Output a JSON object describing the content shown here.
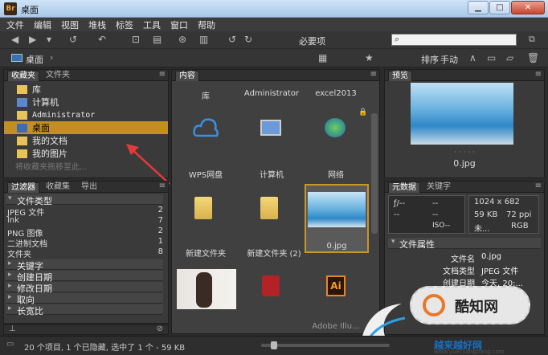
{
  "window": {
    "title": "桌面",
    "app_icon_text": "Br"
  },
  "menu": [
    "文件",
    "编辑",
    "视图",
    "堆栈",
    "标签",
    "工具",
    "窗口",
    "帮助"
  ],
  "toolbar": {
    "workspace": "必要项",
    "search_placeholder": ""
  },
  "path": {
    "crumb": "桌面",
    "sort_label": "排序",
    "sort_value": "手动"
  },
  "favorites": {
    "tabs": [
      "收藏夹",
      "文件夹"
    ],
    "items": [
      {
        "label": "库"
      },
      {
        "label": "计算机"
      },
      {
        "label": "Administrator"
      },
      {
        "label": "桌面",
        "selected": true
      },
      {
        "label": "我的文档"
      },
      {
        "label": "我的图片"
      }
    ],
    "hint": "将收藏夹拖移至此..."
  },
  "filter": {
    "tabs": [
      "过滤器",
      "收藏集",
      "导出"
    ],
    "group_file_type": "文件类型",
    "rows": [
      {
        "label": "JPEG 文件",
        "count": "2"
      },
      {
        "label": "lnk",
        "count": "7"
      },
      {
        "label": "PNG 图像",
        "count": "2"
      },
      {
        "label": "二进制文档",
        "count": "1"
      },
      {
        "label": "文件夹",
        "count": "8"
      }
    ],
    "groups": [
      "关键字",
      "创建日期",
      "修改日期",
      "取向",
      "长宽比"
    ]
  },
  "content": {
    "tab": "内容",
    "items": [
      {
        "label": "库"
      },
      {
        "label": "Administrator"
      },
      {
        "label": "excel2013"
      },
      {
        "label": "WPS网盘"
      },
      {
        "label": "计算机"
      },
      {
        "label": "网络"
      },
      {
        "label": "新建文件夹"
      },
      {
        "label": "新建文件夹 (2)"
      },
      {
        "label": "0.jpg"
      },
      {
        "label": ""
      },
      {
        "label": ""
      },
      {
        "label": "Adobe Illu..."
      }
    ]
  },
  "preview": {
    "tab": "预览",
    "filename": "0.jpg",
    "dots": "· · · · ·"
  },
  "metadata": {
    "tabs": [
      "元数据",
      "关键字"
    ],
    "camera": {
      "fstop": "ƒ/--",
      "shutter": "--",
      "a": "--",
      "b": "--",
      "iso": "ISO--"
    },
    "info": {
      "dims": "1024 x 682",
      "size": "59 KB",
      "ppi": "72 ppi",
      "profile": "未...",
      "mode": "RGB"
    },
    "section": "文件属性",
    "rows": [
      {
        "k": "文件名",
        "v": "0.jpg"
      },
      {
        "k": "文档类型",
        "v": "JPEG 文件"
      },
      {
        "k": "创建日期",
        "v": "今天, 20:..."
      }
    ]
  },
  "status": {
    "text": "20 个项目, 1 个已隐藏, 选中了 1 个 - 59 KB"
  },
  "watermark": {
    "site": "酷知网",
    "site2": "越来越好网",
    "url": "www.yuecyangbang.com"
  },
  "colors": {
    "selection": "#c19021",
    "panel": "#3a3a3a",
    "dark": "#2b2b2b"
  }
}
